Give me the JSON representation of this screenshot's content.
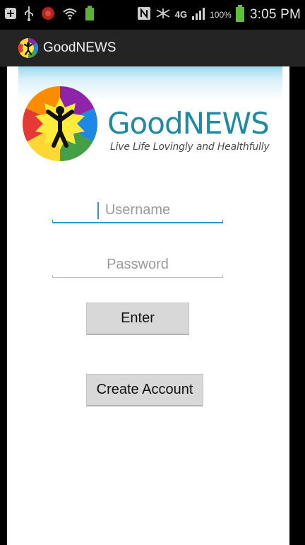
{
  "status_bar": {
    "battery_percent": "100%",
    "time": "3:05 PM",
    "network_label": "4G",
    "icons": [
      "add-notification-icon",
      "usb-icon",
      "shield-icon",
      "wifi-icon",
      "battery-small-icon",
      "nfc-icon",
      "mute-icon",
      "network-4g-icon",
      "signal-icon",
      "battery-icon"
    ]
  },
  "app_bar": {
    "title": "GoodNEWS",
    "icon": "goodnews-logo-icon"
  },
  "banner": {
    "brand": "GoodNEWS",
    "tagline": "Live Life Lovingly and Healthfully",
    "logo_colors": [
      "#e53935",
      "#8e24aa",
      "#1e88e5",
      "#43a047",
      "#fdd835",
      "#fb8c00"
    ]
  },
  "form": {
    "username_placeholder": "Username",
    "username_value": "",
    "password_placeholder": "Password",
    "password_value": "",
    "enter_label": "Enter",
    "create_label": "Create Account"
  },
  "colors": {
    "accent": "#2b9bc4",
    "brand_teal": "#1f8aa0"
  }
}
